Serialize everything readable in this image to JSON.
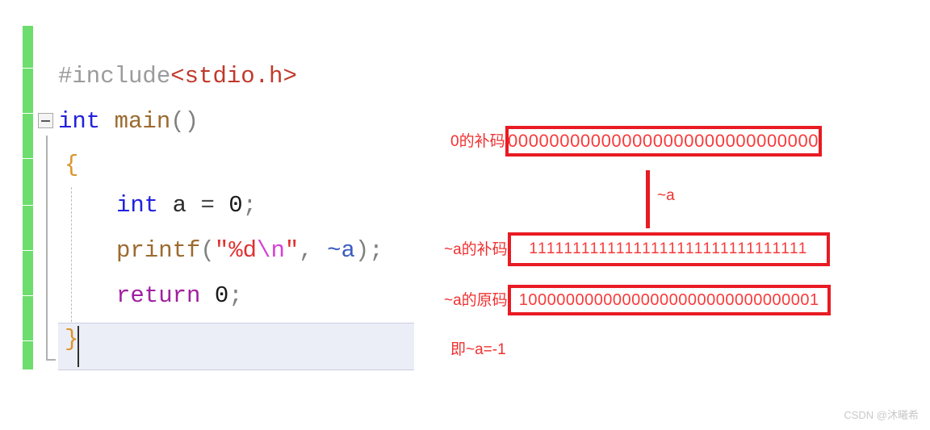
{
  "code_editor": {
    "lines": [
      {
        "id": "include",
        "tokens": [
          {
            "text": "#include",
            "kind": "pre"
          },
          {
            "text": "<stdio.h>",
            "kind": "header"
          }
        ]
      },
      {
        "id": "main-signature",
        "tokens": [
          {
            "text": "int",
            "kind": "kw"
          },
          {
            "text": " ",
            "kind": "plain"
          },
          {
            "text": "main",
            "kind": "fn"
          },
          {
            "text": "()",
            "kind": "punct"
          }
        ]
      },
      {
        "id": "open-brace",
        "tokens": [
          {
            "text": "{",
            "kind": "brace"
          }
        ]
      },
      {
        "id": "declare-a",
        "tokens": [
          {
            "text": "int",
            "kind": "kw"
          },
          {
            "text": " a ",
            "kind": "plain"
          },
          {
            "text": "=",
            "kind": "op"
          },
          {
            "text": " ",
            "kind": "plain"
          },
          {
            "text": "0",
            "kind": "num"
          },
          {
            "text": ";",
            "kind": "punct"
          }
        ]
      },
      {
        "id": "printf-call",
        "tokens": [
          {
            "text": "printf",
            "kind": "fn"
          },
          {
            "text": "(",
            "kind": "punct"
          },
          {
            "text": "\"%d",
            "kind": "str"
          },
          {
            "text": "\\n",
            "kind": "esc"
          },
          {
            "text": "\"",
            "kind": "str"
          },
          {
            "text": ", ",
            "kind": "punct"
          },
          {
            "text": "~a",
            "kind": "var"
          },
          {
            "text": ")",
            "kind": "punct"
          },
          {
            "text": ";",
            "kind": "punct"
          }
        ]
      },
      {
        "id": "return-statement",
        "tokens": [
          {
            "text": "return",
            "kind": "ret"
          },
          {
            "text": " ",
            "kind": "plain"
          },
          {
            "text": "0",
            "kind": "num"
          },
          {
            "text": ";",
            "kind": "punct"
          }
        ]
      },
      {
        "id": "close-brace",
        "tokens": [
          {
            "text": "}",
            "kind": "brace"
          }
        ]
      }
    ],
    "fold_toggle_state": "expanded"
  },
  "binary_diagram": {
    "rows": [
      {
        "id": "zero-complement",
        "label": "0的补码",
        "bits": "00000000000000000000000000000000"
      },
      {
        "id": "na-complement",
        "label": "~a的补码",
        "bits": "11111111111111111111111111111111"
      },
      {
        "id": "na-original",
        "label": "~a的原码",
        "bits": "10000000000000000000000000000001"
      }
    ],
    "connector_label": "~a",
    "conclusion": "即~a=-1"
  },
  "watermark": {
    "text": "CSDN @沐曦希"
  },
  "colors": {
    "box_border": "#e81b23",
    "annotation_red": "#f03030",
    "change_bar_green": "#6ddd6d",
    "current_line_highlight": "#eceef7"
  }
}
